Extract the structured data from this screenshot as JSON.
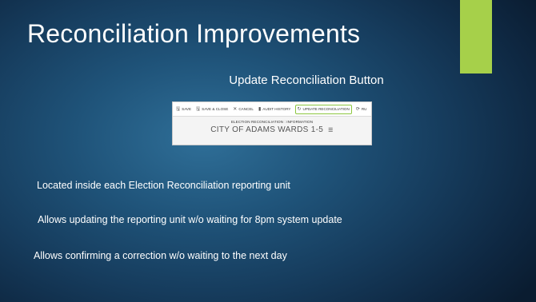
{
  "slide": {
    "title": "Reconciliation Improvements",
    "subtitle": "Update Reconciliation Button",
    "accent_color": "#a6d04a"
  },
  "app": {
    "toolbar": [
      {
        "label": "SAVE",
        "icon": "save-icon",
        "glyph": "🖫"
      },
      {
        "label": "SAVE & CLOSE",
        "icon": "save-close-icon",
        "glyph": "🖫"
      },
      {
        "label": "CANCEL",
        "icon": "close-icon",
        "glyph": "✕"
      },
      {
        "label": "AUDIT HISTORY",
        "icon": "audit-history-icon",
        "glyph": "▮"
      },
      {
        "label": "UPDATE RECONCILIATION",
        "icon": "update-icon",
        "glyph": "↻"
      },
      {
        "label": "RU",
        "icon": "run-icon",
        "glyph": "⟳"
      }
    ],
    "form_label": "ELECTION RECONCILIATION : INFORMATION",
    "record_name": "CITY OF ADAMS WARDS 1-5",
    "menu_glyph": "☰",
    "highlight_color": "#8cc63f"
  },
  "bullets": [
    "Located inside each Election Reconciliation reporting unit",
    "Allows updating the reporting unit w/o waiting for 8pm system update",
    "Allows confirming a correction w/o waiting to the next day"
  ]
}
